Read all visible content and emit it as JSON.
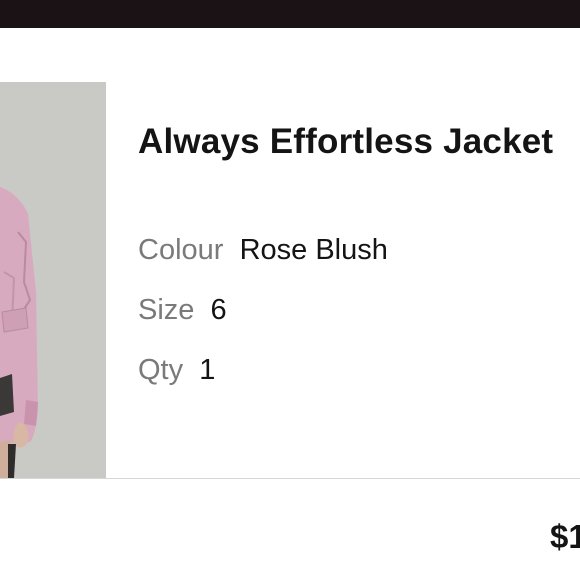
{
  "cart_item": {
    "product_name": "Always Effortless Jacket",
    "attributes": {
      "colour": {
        "label": "Colour",
        "value": "Rose Blush"
      },
      "size": {
        "label": "Size",
        "value": "6"
      },
      "qty": {
        "label": "Qty",
        "value": "1"
      }
    },
    "price": "$1",
    "image_alt_icon": "product-photo"
  },
  "colors": {
    "top_bar": "#1a1214",
    "product_jacket": "#d7a9bf",
    "thumbnail_bg": "#c8c8c5"
  }
}
